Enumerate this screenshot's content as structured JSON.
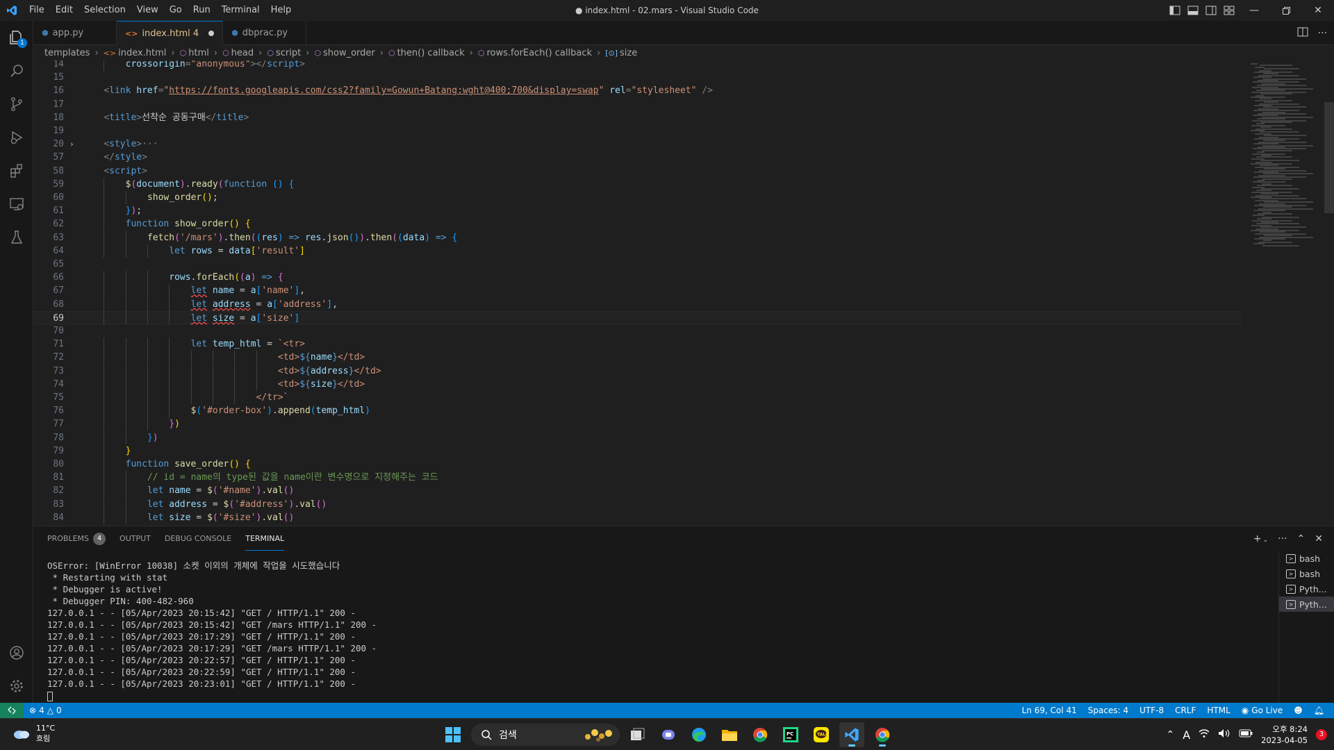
{
  "titlebar": {
    "menu": [
      "File",
      "Edit",
      "Selection",
      "View",
      "Go",
      "Run",
      "Terminal",
      "Help"
    ],
    "window_title": "● index.html - 02.mars - Visual Studio Code"
  },
  "activity_bar": {
    "explorer_badge": "1",
    "icons": [
      "explorer-icon",
      "search-icon",
      "source-control-icon",
      "run-debug-icon",
      "extensions-icon",
      "remote-explorer-icon",
      "testing-icon"
    ],
    "bottom_icons": [
      "account-icon",
      "settings-gear-icon"
    ]
  },
  "tabs": [
    {
      "label": "app.py",
      "icon": "python-icon",
      "active": false
    },
    {
      "label": "index.html 4",
      "icon": "html-icon",
      "active": true,
      "modified": true
    },
    {
      "label": "dbprac.py",
      "icon": "python-icon",
      "active": false
    }
  ],
  "breadcrumb": [
    "templates",
    "index.html",
    "html",
    "head",
    "script",
    "show_order",
    "then() callback",
    "rows.forEach() callback",
    "size"
  ],
  "editor": {
    "current_line": 69,
    "lines": [
      {
        "n": "14",
        "indent": 2,
        "html": "<span class='t-attr'>crossorigin</span><span class='t-punc'>=</span><span class='t-str'>\"anonymous\"</span><span class='t-punc'>&gt;&lt;/</span><span class='t-tag'>script</span><span class='t-punc'>&gt;</span>"
      },
      {
        "n": "15",
        "indent": 0,
        "html": ""
      },
      {
        "n": "16",
        "indent": 1,
        "html": "<span class='t-punc'>&lt;</span><span class='t-tag'>link</span> <span class='t-attr'>href</span><span class='t-punc'>=</span><span class='t-str'>\"</span><span class='t-link'>https://fonts.googleapis.com/css2?family=Gowun+Batang:wght@400;700&amp;display=swap</span><span class='t-str'>\"</span> <span class='t-attr'>rel</span><span class='t-punc'>=</span><span class='t-str'>\"stylesheet\"</span> <span class='t-punc'>/&gt;</span>"
      },
      {
        "n": "17",
        "indent": 0,
        "html": ""
      },
      {
        "n": "18",
        "indent": 1,
        "html": "<span class='t-punc'>&lt;</span><span class='t-tag'>title</span><span class='t-punc'>&gt;</span>선착순 공동구매<span class='t-punc'>&lt;/</span><span class='t-tag'>title</span><span class='t-punc'>&gt;</span>"
      },
      {
        "n": "19",
        "indent": 0,
        "html": ""
      },
      {
        "n": "20",
        "indent": 1,
        "fold": true,
        "html": "<span class='t-punc'>&lt;</span><span class='t-tag'>style</span><span class='t-punc'>&gt;</span><span class='t-punc'>···</span>"
      },
      {
        "n": "57",
        "indent": 1,
        "html": "<span class='t-punc'>&lt;/</span><span class='t-tag'>style</span><span class='t-punc'>&gt;</span>"
      },
      {
        "n": "58",
        "indent": 1,
        "html": "<span class='t-punc'>&lt;</span><span class='t-tag'>script</span><span class='t-punc'>&gt;</span>"
      },
      {
        "n": "59",
        "indent": 2,
        "html": "<span class='t-fn'>$</span><span class='t-brace2'>(</span><span class='t-var'>document</span><span class='t-brace2'>)</span>.<span class='t-fn'>ready</span><span class='t-brace2'>(</span><span class='t-kw'>function</span> <span class='t-brace3'>()</span> <span class='t-brace3'>{</span>"
      },
      {
        "n": "60",
        "indent": 3,
        "html": "<span class='t-fn'>show_order</span><span class='t-brace1'>()</span>;"
      },
      {
        "n": "61",
        "indent": 2,
        "html": "<span class='t-brace3'>}</span><span class='t-brace2'>)</span>;"
      },
      {
        "n": "62",
        "indent": 2,
        "html": "<span class='t-kw'>function</span> <span class='t-fn'>show_order</span><span class='t-brace1'>()</span> <span class='t-brace1'>{</span>"
      },
      {
        "n": "63",
        "indent": 3,
        "html": "<span class='t-fn'>fetch</span><span class='t-brace2'>(</span><span class='t-str'>'/mars'</span><span class='t-brace2'>)</span>.<span class='t-fn'>then</span><span class='t-brace2'>(</span><span class='t-brace3'>(</span><span class='t-var'>res</span><span class='t-brace3'>)</span> <span class='t-kw'>=&gt;</span> <span class='t-var'>res</span>.<span class='t-fn'>json</span><span class='t-brace3'>()</span><span class='t-brace2'>)</span>.<span class='t-fn'>then</span><span class='t-brace2'>(</span><span class='t-brace3'>(</span><span class='t-var'>data</span><span class='t-brace3'>)</span> <span class='t-kw'>=&gt;</span> <span class='t-brace3'>{</span>"
      },
      {
        "n": "64",
        "indent": 4,
        "html": "<span class='t-kw'>let</span> <span class='t-var'>rows</span> = <span class='t-var'>data</span><span class='t-brace1'>[</span><span class='t-str'>'result'</span><span class='t-brace1'>]</span>"
      },
      {
        "n": "65",
        "indent": 0,
        "html": ""
      },
      {
        "n": "66",
        "indent": 4,
        "html": "<span class='t-var'>rows</span>.<span class='t-fn'>forEach</span><span class='t-brace1'>(</span><span class='t-brace2'>(</span><span class='t-var'>a</span><span class='t-brace2'>)</span> <span class='t-kw'>=&gt;</span> <span class='t-brace2'>{</span>"
      },
      {
        "n": "67",
        "indent": 5,
        "html": "<span class='t-kw squiggle'>let</span> <span class='t-var'>name</span> = <span class='t-var'>a</span><span class='t-brace3'>[</span><span class='t-str'>'name'</span><span class='t-brace3'>]</span>,"
      },
      {
        "n": "68",
        "indent": 5,
        "html": "<span class='t-kw squiggle'>let</span> <span class='t-var squiggle'>address</span> = <span class='t-var'>a</span><span class='t-brace3'>[</span><span class='t-str'>'address'</span><span class='t-brace3'>]</span>,"
      },
      {
        "n": "69",
        "indent": 5,
        "html": "<span class='t-kw squiggle'>let</span> <span class='t-var squiggle'>size</span> = <span class='t-var'>a</span><span class='t-brace3'>[</span><span class='t-str'>'size'</span><span class='t-brace3'>]</span>"
      },
      {
        "n": "70",
        "indent": 0,
        "html": ""
      },
      {
        "n": "71",
        "indent": 5,
        "html": "<span class='t-kw'>let</span> <span class='t-var'>temp_html</span> = <span class='t-str'>`&lt;tr&gt;</span>"
      },
      {
        "n": "72",
        "indent": 9,
        "html": "<span class='t-str'>&lt;td&gt;</span><span class='t-kw'>${</span><span class='t-var'>name</span><span class='t-kw'>}</span><span class='t-str'>&lt;/td&gt;</span>"
      },
      {
        "n": "73",
        "indent": 9,
        "html": "<span class='t-str'>&lt;td&gt;</span><span class='t-kw'>${</span><span class='t-var'>address</span><span class='t-kw'>}</span><span class='t-str'>&lt;/td&gt;</span>"
      },
      {
        "n": "74",
        "indent": 9,
        "html": "<span class='t-str'>&lt;td&gt;</span><span class='t-kw'>${</span><span class='t-var'>size</span><span class='t-kw'>}</span><span class='t-str'>&lt;/td&gt;</span>"
      },
      {
        "n": "75",
        "indent": 8,
        "html": "<span class='t-str'>&lt;/tr&gt;`</span>"
      },
      {
        "n": "76",
        "indent": 5,
        "html": "<span class='t-fn'>$</span><span class='t-brace3'>(</span><span class='t-str'>'#order-box'</span><span class='t-brace3'>)</span>.<span class='t-fn'>append</span><span class='t-brace3'>(</span><span class='t-var'>temp_html</span><span class='t-brace3'>)</span>"
      },
      {
        "n": "77",
        "indent": 4,
        "html": "<span class='t-brace2'>}</span><span class='t-brace1'>)</span>"
      },
      {
        "n": "78",
        "indent": 3,
        "html": "<span class='t-brace3'>}</span><span class='t-brace2'>)</span>"
      },
      {
        "n": "79",
        "indent": 2,
        "html": "<span class='t-brace1'>}</span>"
      },
      {
        "n": "80",
        "indent": 2,
        "html": "<span class='t-kw'>function</span> <span class='t-fn'>save_order</span><span class='t-brace1'>()</span> <span class='t-brace1'>{</span>"
      },
      {
        "n": "81",
        "indent": 3,
        "html": "<span class='t-com'>// id = name의 type된 값을 name이란 변수명으로 지정해주는 코드</span>"
      },
      {
        "n": "82",
        "indent": 3,
        "html": "<span class='t-kw'>let</span> <span class='t-var'>name</span> = <span class='t-fn'>$</span><span class='t-brace2'>(</span><span class='t-str'>'#name'</span><span class='t-brace2'>)</span>.<span class='t-fn'>val</span><span class='t-brace2'>()</span>"
      },
      {
        "n": "83",
        "indent": 3,
        "html": "<span class='t-kw'>let</span> <span class='t-var'>address</span> = <span class='t-fn'>$</span><span class='t-brace2'>(</span><span class='t-str'>'#address'</span><span class='t-brace2'>)</span>.<span class='t-fn'>val</span><span class='t-brace2'>()</span>"
      },
      {
        "n": "84",
        "indent": 3,
        "html": "<span class='t-kw'>let</span> <span class='t-var'>size</span> = <span class='t-fn'>$</span><span class='t-brace2'>(</span><span class='t-str'>'#size'</span><span class='t-brace2'>)</span>.<span class='t-fn'>val</span><span class='t-brace2'>()</span>"
      }
    ]
  },
  "panel": {
    "tabs": [
      {
        "label": "PROBLEMS",
        "badge": "4",
        "active": false
      },
      {
        "label": "OUTPUT",
        "active": false
      },
      {
        "label": "DEBUG CONSOLE",
        "active": false
      },
      {
        "label": "TERMINAL",
        "active": true
      }
    ],
    "terminal_lines": [
      "OSError: [WinError 10038] 소켓 이외의 개체에 작업을 시도했습니다",
      " * Restarting with stat",
      " * Debugger is active!",
      " * Debugger PIN: 400-482-960",
      "127.0.0.1 - - [05/Apr/2023 20:15:42] \"GET / HTTP/1.1\" 200 -",
      "127.0.0.1 - - [05/Apr/2023 20:15:42] \"GET /mars HTTP/1.1\" 200 -",
      "127.0.0.1 - - [05/Apr/2023 20:17:29] \"GET / HTTP/1.1\" 200 -",
      "127.0.0.1 - - [05/Apr/2023 20:17:29] \"GET /mars HTTP/1.1\" 200 -",
      "127.0.0.1 - - [05/Apr/2023 20:22:57] \"GET / HTTP/1.1\" 200 -",
      "127.0.0.1 - - [05/Apr/2023 20:22:59] \"GET / HTTP/1.1\" 200 -",
      "127.0.0.1 - - [05/Apr/2023 20:23:01] \"GET / HTTP/1.1\" 200 -"
    ],
    "terminals": [
      {
        "label": "bash",
        "selected": false
      },
      {
        "label": "bash",
        "selected": false
      },
      {
        "label": "Pyth...",
        "selected": false
      },
      {
        "label": "Pyth...",
        "selected": true
      }
    ]
  },
  "statusbar": {
    "errors": "4",
    "warnings": "0",
    "position": "Ln 69, Col 41",
    "spaces": "Spaces: 4",
    "encoding": "UTF-8",
    "eol": "CRLF",
    "language": "HTML",
    "go_live": "Go Live"
  },
  "taskbar": {
    "temperature": "11°C",
    "weather": "흐림",
    "search_placeholder": "검색",
    "clock_time": "오후 8:24",
    "clock_date": "2023-04-05",
    "notification_count": "3",
    "ime_indicator": "A",
    "apps": [
      "windows-start-icon",
      "task-view-icon",
      "teams-chat-icon",
      "edge-icon",
      "file-explorer-icon",
      "chrome-icon",
      "pycharm-icon",
      "kakaotalk-icon",
      "vscode-icon",
      "chrome-icon"
    ]
  },
  "colors": {
    "statusbar": "#007acc",
    "accent": "#0078d4",
    "remote": "#16825d"
  }
}
